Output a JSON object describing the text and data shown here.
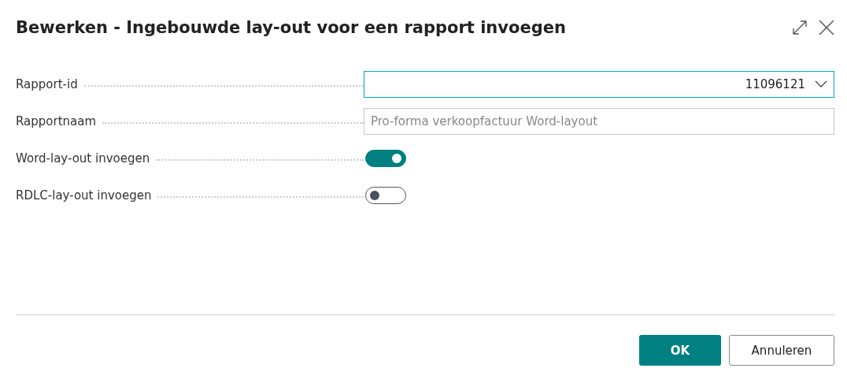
{
  "dialog": {
    "title": "Bewerken - Ingebouwde lay-out voor een rapport invoegen"
  },
  "fields": [
    {
      "kind": "dropdown",
      "label": "Rapport-id",
      "value": "11096121",
      "focused": true,
      "disabled": false
    },
    {
      "kind": "text",
      "label": "Rapportnaam",
      "value": "Pro-forma verkoopfactuur Word-layout",
      "focused": false,
      "disabled": true
    },
    {
      "kind": "toggle",
      "label": "Word-lay-out invoegen",
      "on": true
    },
    {
      "kind": "toggle",
      "label": "RDLC-lay-out invoegen",
      "on": false
    }
  ],
  "buttons": [
    {
      "label": "OK",
      "kind": "primary"
    },
    {
      "label": "Annuleren",
      "kind": "secondary"
    }
  ]
}
